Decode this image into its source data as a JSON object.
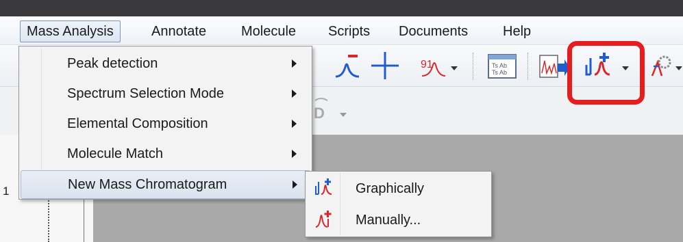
{
  "menubar": {
    "items": [
      {
        "label": "Mass Analysis",
        "active": true
      },
      {
        "label": "Annotate"
      },
      {
        "label": "Molecule"
      },
      {
        "label": "Scripts"
      },
      {
        "label": "Documents"
      },
      {
        "label": "Help"
      }
    ]
  },
  "dropdown": {
    "items": [
      {
        "label": "Peak detection",
        "has_submenu": true
      },
      {
        "label": "Spectrum Selection Mode",
        "has_submenu": true
      },
      {
        "label": "Elemental Composition",
        "has_submenu": true
      },
      {
        "label": "Molecule Match",
        "has_submenu": true
      },
      {
        "label": "New Mass Chromatogram",
        "has_submenu": true,
        "highlighted": true
      }
    ]
  },
  "submenu": {
    "items": [
      {
        "label": "Graphically",
        "icon": "graphical-chromatogram-icon"
      },
      {
        "label": "Manually...",
        "icon": "manual-chromatogram-icon"
      }
    ]
  },
  "toolbar": {
    "icons": [
      "peak-minus-icon",
      "crosshair-icon",
      "peak-label-icon",
      "table-view-icon",
      "spectrum-export-icon",
      "new-mass-chromatogram-icon",
      "molecule-settings-icon"
    ]
  },
  "left_panel": {
    "number": "1"
  },
  "colors": {
    "highlight": "#e41e1e",
    "icon_blue": "#1f5ccf",
    "icon_red": "#d8262b"
  }
}
